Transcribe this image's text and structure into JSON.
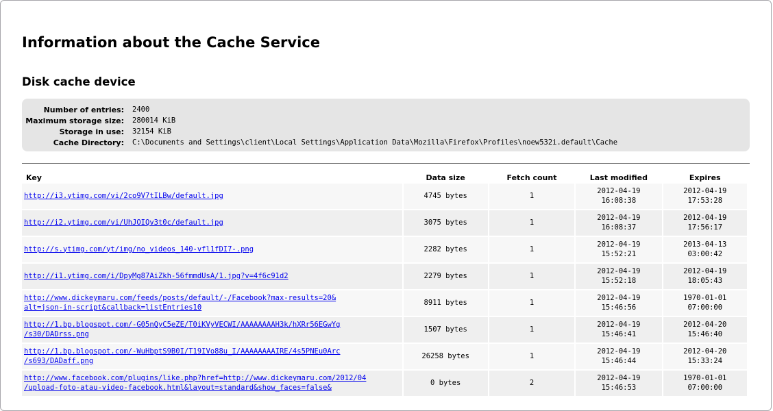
{
  "page": {
    "title": "Information about the Cache Service",
    "section_title": "Disk cache device"
  },
  "device": {
    "entries_label": "Number of entries:",
    "entries_value": "2400",
    "max_size_label": "Maximum storage size:",
    "max_size_value": "280014 KiB",
    "in_use_label": "Storage in use:",
    "in_use_value": "32154 KiB",
    "dir_label": "Cache Directory:",
    "dir_value": "C:\\Documents and Settings\\client\\Local Settings\\Application Data\\Mozilla\\Firefox\\Profiles\\noew532i.default\\Cache"
  },
  "table": {
    "headers": {
      "key": "Key",
      "size": "Data size",
      "fetch": "Fetch count",
      "modified": "Last modified",
      "expires": "Expires"
    },
    "rows": [
      {
        "key": "http://i3.ytimg.com/vi/2co9V7tILBw/default.jpg",
        "size": "4745 bytes",
        "fetch": "1",
        "mod_date": "2012-04-19",
        "mod_time": "16:08:38",
        "exp_date": "2012-04-19",
        "exp_time": "17:53:28"
      },
      {
        "key": "http://i2.ytimg.com/vi/UhJOIQv3t0c/default.jpg",
        "size": "3075 bytes",
        "fetch": "1",
        "mod_date": "2012-04-19",
        "mod_time": "16:08:37",
        "exp_date": "2012-04-19",
        "exp_time": "17:56:17"
      },
      {
        "key": "http://s.ytimg.com/yt/img/no_videos_140-vfl1fDI7-.png",
        "size": "2282 bytes",
        "fetch": "1",
        "mod_date": "2012-04-19",
        "mod_time": "15:52:21",
        "exp_date": "2013-04-13",
        "exp_time": "03:00:42"
      },
      {
        "key": "http://i1.ytimg.com/i/DpyMg87AiZkh-56fmmdUsA/1.jpg?v=4f6c91d2",
        "size": "2279 bytes",
        "fetch": "1",
        "mod_date": "2012-04-19",
        "mod_time": "15:52:18",
        "exp_date": "2012-04-19",
        "exp_time": "18:05:43"
      },
      {
        "key": "http://www.dickeymaru.com/feeds/posts/default/-/Facebook?max-results=20&\nalt=json-in-script&callback=listEntries10",
        "size": "8911 bytes",
        "fetch": "1",
        "mod_date": "2012-04-19",
        "mod_time": "15:46:56",
        "exp_date": "1970-01-01",
        "exp_time": "07:00:00"
      },
      {
        "key": "http://1.bp.blogspot.com/-G05nQyC5eZE/T0iKVyVECWI/AAAAAAAAH3k/hXRr56EGwYg\n/s30/DADrss.png",
        "size": "1507 bytes",
        "fetch": "1",
        "mod_date": "2012-04-19",
        "mod_time": "15:46:41",
        "exp_date": "2012-04-20",
        "exp_time": "15:46:40"
      },
      {
        "key": "http://1.bp.blogspot.com/-WuHbptS9B0I/T19IVo88u_I/AAAAAAAAIRE/4s5PNEu0Arc\n/s693/DADaff.png",
        "size": "26258 bytes",
        "fetch": "1",
        "mod_date": "2012-04-19",
        "mod_time": "15:46:44",
        "exp_date": "2012-04-20",
        "exp_time": "15:33:24"
      },
      {
        "key": "http://www.facebook.com/plugins/like.php?href=http://www.dickeymaru.com/2012/04\n/upload-foto-atau-video-facebook.html&layout=standard&show_faces=false&",
        "size": "0 bytes",
        "fetch": "2",
        "mod_date": "2012-04-19",
        "mod_time": "15:46:53",
        "exp_date": "1970-01-01",
        "exp_time": "07:00:00"
      }
    ]
  }
}
